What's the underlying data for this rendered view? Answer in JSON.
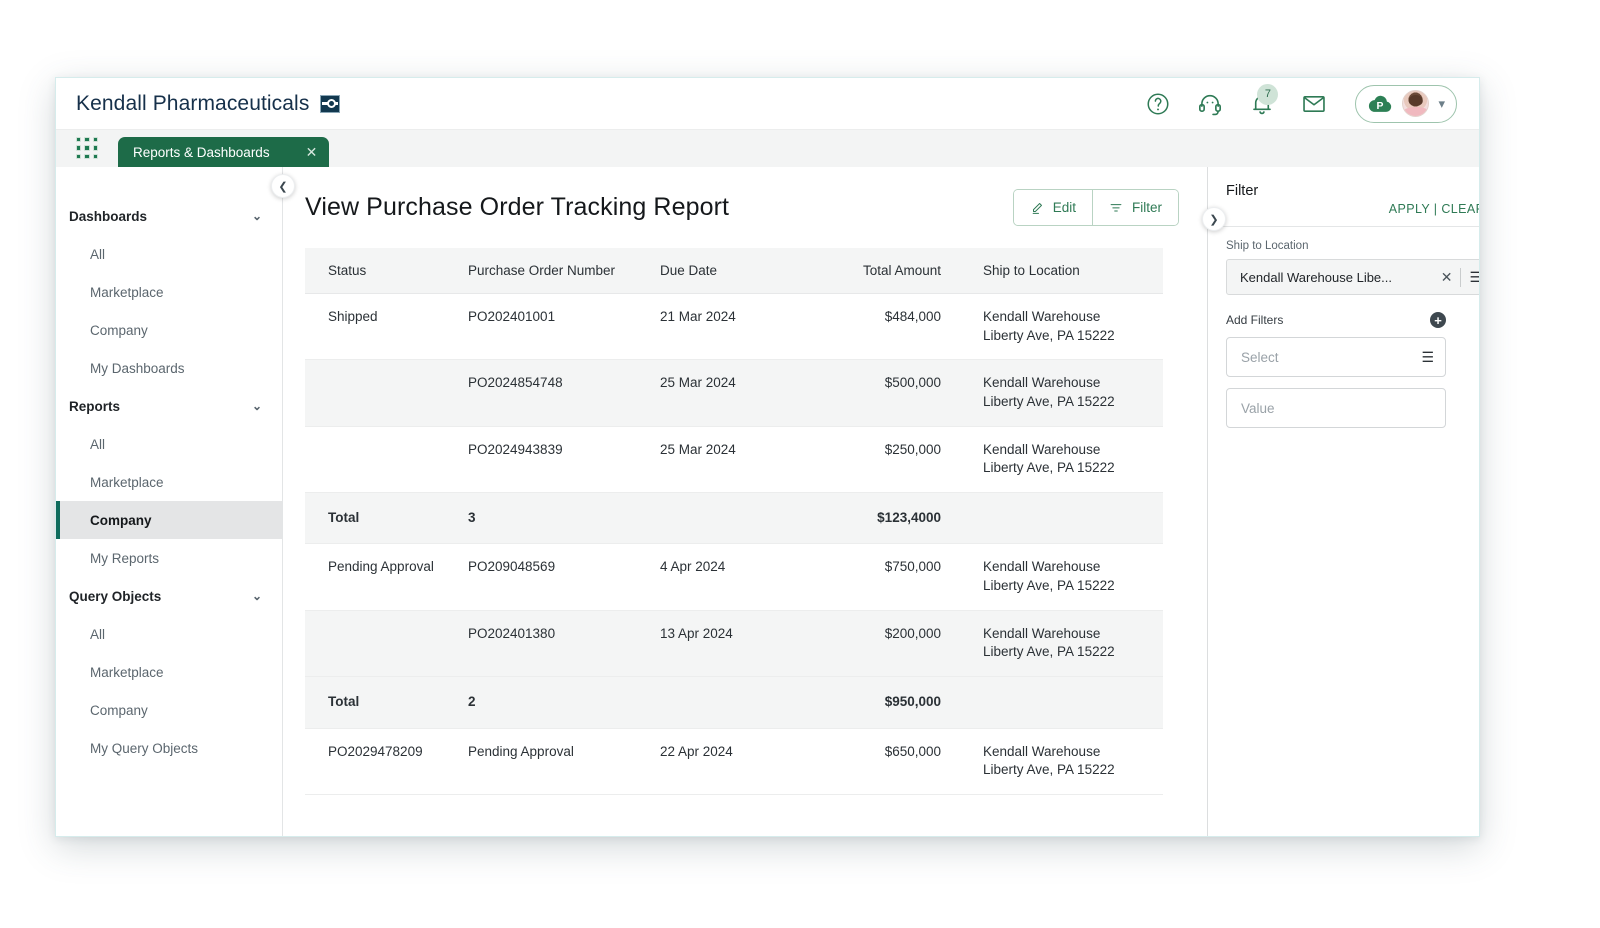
{
  "brand": {
    "title": "Kendall Pharmaceuticals",
    "logo_icon": "kendall-square-logo"
  },
  "topbar": {
    "help_icon": "question-circle-icon",
    "support_icon": "headset-icon",
    "notifications_icon": "bell-icon",
    "notifications_count": "7",
    "mail_icon": "envelope-icon",
    "cloud_icon": "cloud-p-icon",
    "avatar_icon": "user-avatar",
    "chevron_icon": "chevron-down-icon"
  },
  "tabbar": {
    "launcher_icon": "grid-apps-icon",
    "tab_label": "Reports & Dashboards",
    "close_icon": "close-icon"
  },
  "sidebar": {
    "collapse_icon": "chevron-left-icon",
    "groups": [
      {
        "label": "Dashboards",
        "chevron": "⌄",
        "items": [
          {
            "label": "All",
            "active": false
          },
          {
            "label": "Marketplace",
            "active": false
          },
          {
            "label": "Company",
            "active": false
          },
          {
            "label": "My Dashboards",
            "active": false
          }
        ]
      },
      {
        "label": "Reports",
        "chevron": "⌄",
        "items": [
          {
            "label": "All",
            "active": false
          },
          {
            "label": "Marketplace",
            "active": false
          },
          {
            "label": "Company",
            "active": true
          },
          {
            "label": "My Reports",
            "active": false
          }
        ]
      },
      {
        "label": "Query Objects",
        "chevron": "⌄",
        "items": [
          {
            "label": "All",
            "active": false
          },
          {
            "label": "Marketplace",
            "active": false
          },
          {
            "label": "Company",
            "active": false
          },
          {
            "label": "My Query Objects",
            "active": false
          }
        ]
      }
    ]
  },
  "main": {
    "title": "View Purchase Order Tracking Report",
    "edit_label": "Edit",
    "edit_icon": "pencil-icon",
    "filter_label": "Filter",
    "filter_icon": "funnel-icon"
  },
  "table": {
    "columns": [
      "Status",
      "Purchase Order Number",
      "Due Date",
      "Total Amount",
      "Ship to Location"
    ],
    "rows": [
      {
        "type": "data",
        "status": "Shipped",
        "po": "PO202401001",
        "due": "21 Mar 2024",
        "amount": "$484,000",
        "ship_line1": "Kendall Warehouse",
        "ship_line2": "Liberty Ave, PA 15222"
      },
      {
        "type": "data",
        "status": "",
        "po": "PO2024854748",
        "due": "25 Mar 2024",
        "amount": "$500,000",
        "ship_line1": "Kendall Warehouse",
        "ship_line2": "Liberty Ave, PA 15222"
      },
      {
        "type": "data",
        "status": "",
        "po": "PO2024943839",
        "due": "25 Mar 2024",
        "amount": "$250,000",
        "ship_line1": "Kendall Warehouse",
        "ship_line2": "Liberty Ave, PA 15222"
      },
      {
        "type": "total",
        "status": "Total",
        "po": "3",
        "due": "",
        "amount": "$123,4000",
        "ship_line1": "",
        "ship_line2": ""
      },
      {
        "type": "data",
        "status": "Pending Approval",
        "po": "PO209048569",
        "due": "4 Apr 2024",
        "amount": "$750,000",
        "ship_line1": "Kendall Warehouse",
        "ship_line2": "Liberty Ave, PA 15222"
      },
      {
        "type": "data",
        "status": "",
        "po": "PO202401380",
        "due": "13 Apr 2024",
        "amount": "$200,000",
        "ship_line1": "Kendall Warehouse",
        "ship_line2": "Liberty Ave, PA 15222"
      },
      {
        "type": "total",
        "status": "Total",
        "po": "2",
        "due": "",
        "amount": "$950,000",
        "ship_line1": "",
        "ship_line2": ""
      },
      {
        "type": "data",
        "status": "PO2029478209",
        "po": "Pending Approval",
        "due": "22 Apr 2024",
        "amount": "$650,000",
        "ship_line1": "Kendall Warehouse",
        "ship_line2": "Liberty Ave, PA 15222"
      }
    ]
  },
  "filter_panel": {
    "expand_icon": "chevron-right-icon",
    "heading": "Filter",
    "apply_label": "APPLY",
    "separator": "|",
    "clear_label": "CLEAR",
    "ship_to_label": "Ship to Location",
    "ship_to_value": "Kendall Warehouse Libe...",
    "token_remove_icon": "close-icon",
    "token_menu_icon": "list-menu-icon",
    "add_filters_label": "Add Filters",
    "add_icon": "plus-circle-icon",
    "select_placeholder": "Select",
    "select_menu_icon": "list-menu-icon",
    "value_placeholder": "Value"
  },
  "colors": {
    "brand_green": "#1d6b48",
    "accent_green": "#2f7a55",
    "active_border": "#0f6b5c",
    "logo_navy": "#12384f",
    "row_alt": "#f4f5f5"
  }
}
